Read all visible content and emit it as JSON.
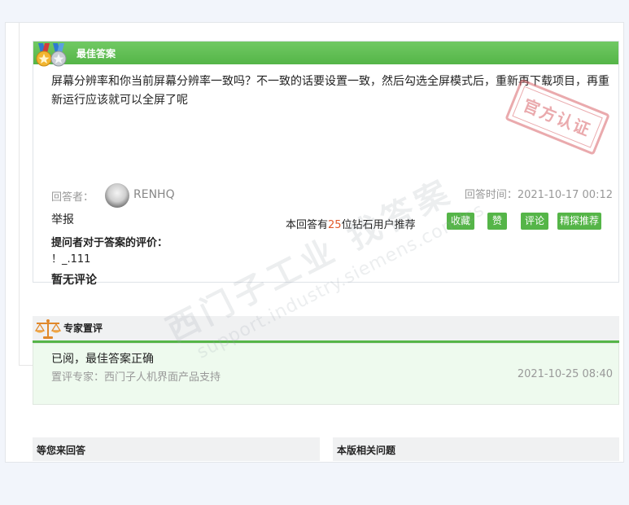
{
  "best_answer": {
    "header_title": "最佳答案",
    "text": "屏幕分辨率和你当前屏幕分辨率一致吗？不一致的话要设置一致，然后勾选全屏模式后，重新再下载项目，再重新运行应该就可以全屏了呢",
    "stamp_text": "官方认证",
    "answerer_label": "回答者：",
    "answerer_name": "RENHQ",
    "answer_time": "回答时间：2021-10-17 00:12",
    "report_label": "举报",
    "recommend_prefix": "本回答有",
    "recommend_count": "25",
    "recommend_suffix": "位钻石用户推荐",
    "buttons": {
      "collect": "收藏",
      "like": "赞1",
      "comment": "评论",
      "featured": "精探推荐"
    },
    "asker_eval_label": "提问者对于答案的评价：",
    "asker_eval_content": "！_.111",
    "no_comments": "暂无评论"
  },
  "expert_review": {
    "header_title": "专家置评",
    "verdict": "已阅，最佳答案正确",
    "expert_label": "置评专家：西门子人机界面产品支持",
    "time": "2021-10-25 08:40"
  },
  "bottom": {
    "left_title": "等您来回答",
    "right_title": "本版相关问题"
  },
  "watermark": {
    "cn": "西门子工业 找答案",
    "en": "support.industry.siemens.com/cs"
  },
  "colors": {
    "accent_green": "#55b548",
    "stamp_red": "#d9656b",
    "recommend_count": "#e0592a"
  }
}
